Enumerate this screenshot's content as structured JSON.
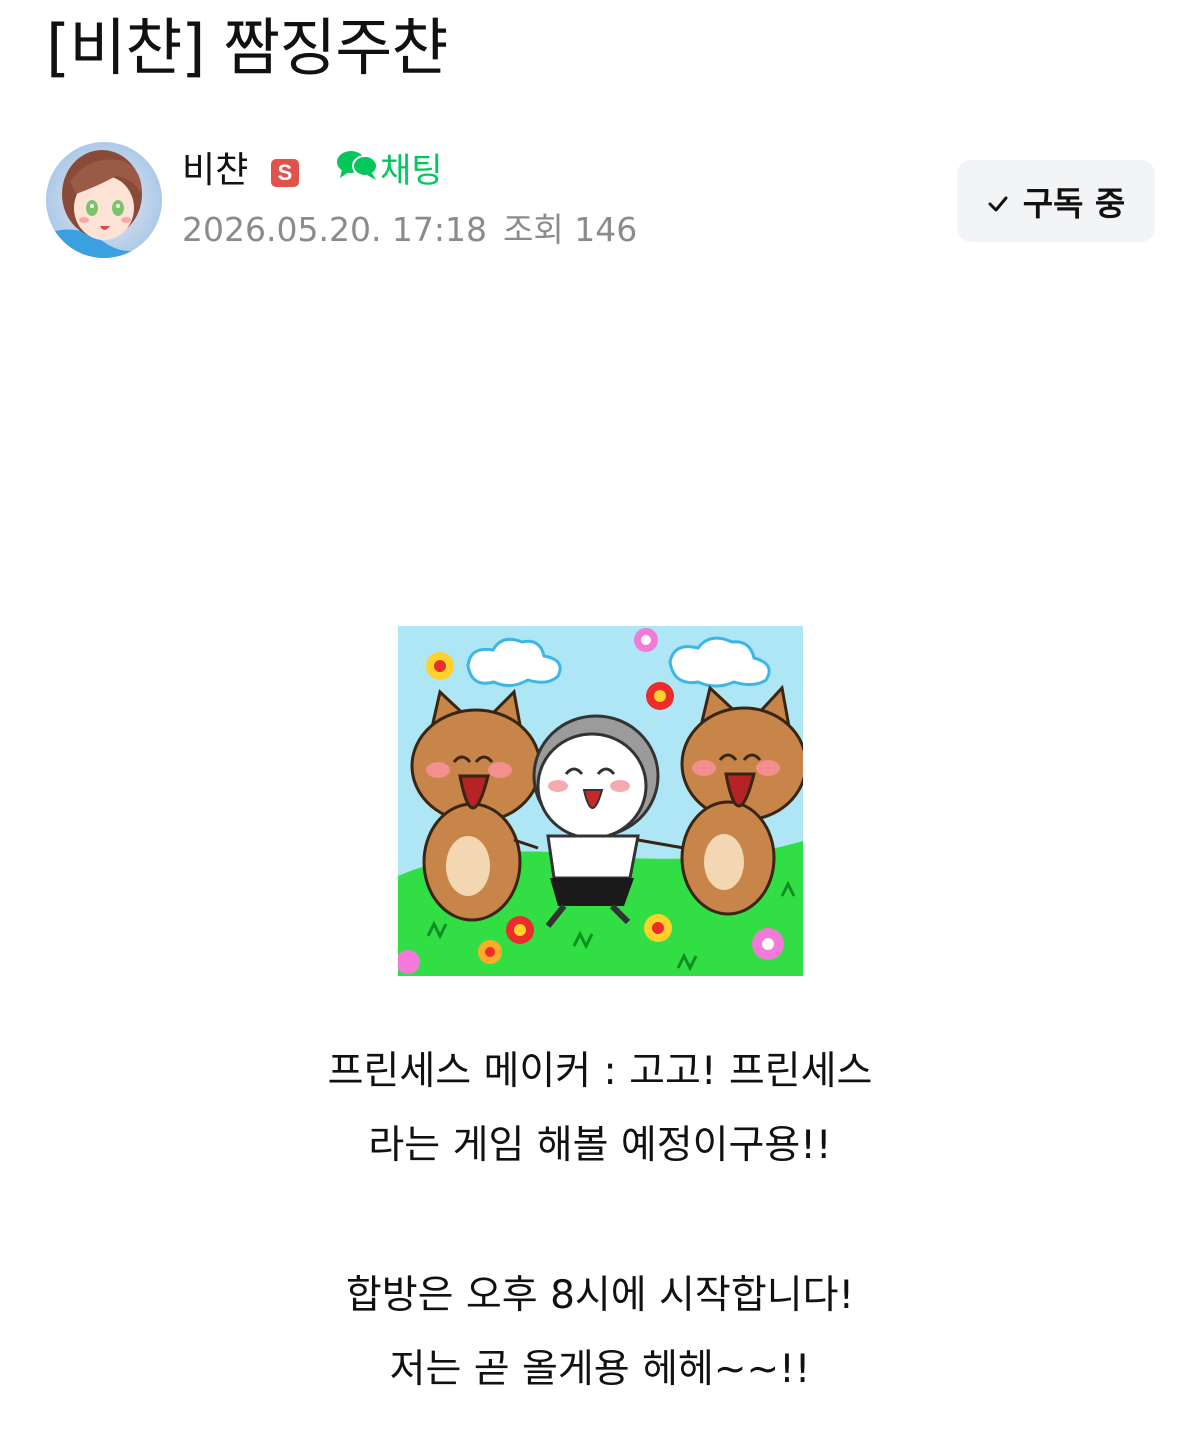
{
  "post": {
    "title": "[비챤] 짬징주챤"
  },
  "author": {
    "name": "비챤",
    "badge_letter": "S",
    "chat_label": "채팅",
    "chat_color": "#03c75a",
    "badge_color": "#e0534a",
    "date": "2026.05.20. 17:18",
    "views": "조회 146"
  },
  "subscribe": {
    "label": "구독 중"
  },
  "content": {
    "image_alt": "three cartoon characters holding hands in a flower field",
    "lines": [
      "프린세스 메이커 : 고고! 프린세스",
      "라는 게임 해볼 예정이구용!!",
      "합방은 오후 8시에 시작합니다!",
      "저는 곧 올게용 헤헤~~!!"
    ]
  }
}
